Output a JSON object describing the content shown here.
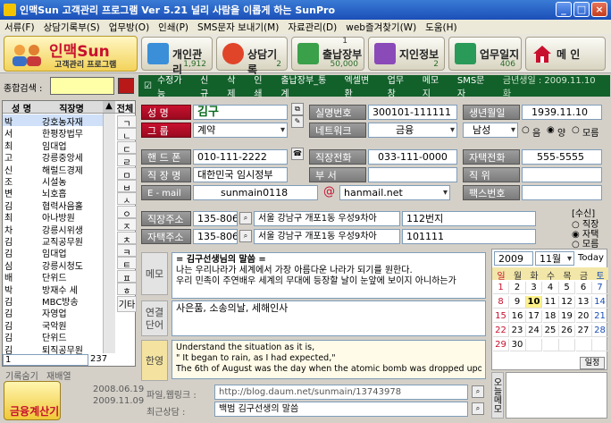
{
  "window": {
    "title": "인맥Sun 고객관리 프로그램 Ver 5.21 널리 사람을 이롭게 하는 SunPro",
    "min": "_",
    "max": "□",
    "close": "×"
  },
  "menu": [
    "서류(F)",
    "상담기록부(S)",
    "업무방(O)",
    "인쇄(P)",
    "SMS문자 보내기(M)",
    "자료관리(D)",
    "web즐겨찾기(W)",
    "도움(H)"
  ],
  "logo": {
    "title": "인맥Sun",
    "subtitle": "고객관리 프로그램"
  },
  "toolbar": [
    {
      "label": "개인관리",
      "count": "1,912",
      "top": ""
    },
    {
      "label": "상담기록",
      "count": "2",
      "top": ""
    },
    {
      "label": "출납장부",
      "count": "50,000",
      "top": "1"
    },
    {
      "label": "지인정보",
      "count": "2",
      "top": ""
    },
    {
      "label": "업무일지",
      "count": "406",
      "top": ""
    },
    {
      "label": "메 인",
      "count": "",
      "top": ""
    }
  ],
  "search": {
    "label": "종합검색 :",
    "value": ""
  },
  "greenbar": {
    "items": [
      "수정가능",
      "신규",
      "삭제",
      "인쇄",
      "출납장부_통계",
      "엑셀변환",
      "업무창",
      "메모지",
      "SMS문자"
    ],
    "date": "금년생일 : 2009.11.10 화"
  },
  "list": {
    "headers": [
      "성 명",
      "직장명",
      "전체"
    ],
    "rows": [
      {
        "name": "박",
        "job": "강호농자재"
      },
      {
        "name": "서",
        "job": "한평장법무"
      },
      {
        "name": "최",
        "job": "임대업"
      },
      {
        "name": "고",
        "job": "강릉중앙세"
      },
      {
        "name": "신",
        "job": "해럴드경제"
      },
      {
        "name": "조",
        "job": "시설농"
      },
      {
        "name": "변",
        "job": "뇌호흡"
      },
      {
        "name": "김",
        "job": "협력사음홀"
      },
      {
        "name": "최",
        "job": "아나방원"
      },
      {
        "name": "차",
        "job": "강릉시위생"
      },
      {
        "name": "김",
        "job": "교직공무원"
      },
      {
        "name": "김",
        "job": "임대업"
      },
      {
        "name": "심",
        "job": "강릉시청도"
      },
      {
        "name": "배",
        "job": "단위드"
      },
      {
        "name": "박",
        "job": "방재수 세"
      },
      {
        "name": "김",
        "job": "MBC방송"
      },
      {
        "name": "김",
        "job": "자영업"
      },
      {
        "name": "김",
        "job": "국악원"
      },
      {
        "name": "김",
        "job": "단위드"
      },
      {
        "name": "김",
        "job": "퇴직공무원"
      }
    ],
    "index": [
      "ㄱ",
      "ㄴ",
      "ㄷ",
      "ㄹ",
      "ㅁ",
      "ㅂ",
      "ㅅ",
      "ㅇ",
      "ㅈ",
      "ㅊ",
      "ㅋ",
      "ㅌ",
      "ㅍ",
      "ㅎ",
      "기타"
    ],
    "input_value": "1",
    "total": "237",
    "footer": [
      "기록숨기",
      "재배열"
    ],
    "dates": [
      "2008.06.19",
      "2009.11.09"
    ]
  },
  "form": {
    "name_label": "성 명",
    "name_value": "김구",
    "cat_label": "그 룹",
    "cat_value": "계약",
    "id_label": "실명번호",
    "id_value": "300101-111111",
    "birth_label": "생년월일",
    "birth_value": "1939.11.10",
    "net_label": "네트워크",
    "net_value": "금융",
    "gender_value": "남성",
    "radio": [
      "음",
      "양",
      "모름"
    ],
    "phone_label": "핸 드 폰",
    "phone_value": "010-111-2222",
    "work_label": "직 장 명",
    "work_value": "대한민국 임시정부",
    "email_label": "E - mail",
    "email_value": "sunmain0118",
    "email_domain": "hanmail.net",
    "wphone_label": "직장전화",
    "wphone_value": "033-111-0000",
    "dept_label": "부 서",
    "dept_value": "",
    "home_label": "자택전화",
    "home_value": "555-5555",
    "pos_label": "직 위",
    "pos_value": "",
    "fax_label": "팩스번호",
    "fax_value": "",
    "waddr_label": "직장주소",
    "waddr_zip": "135-806",
    "waddr1": "서울 강남구 개포1동 우성9차아",
    "waddr2": "112번지",
    "haddr_label": "자택주소",
    "haddr_zip": "135-806",
    "haddr1": "서울 강남구 개포1동 우성9차아",
    "haddr2": "101111",
    "recv_label": "[수신]",
    "recv_options": [
      "직장",
      "자택",
      "모름"
    ]
  },
  "memo": {
    "label": "메모",
    "lines": [
      "= 김구선생님의 말씀 =",
      "나는 우리나라가 세계에서 가장 아름다운 나라가 되기를 원한다.",
      "우리 민족이 주연배우 세계의 무대에 등장할 날이 눈앞에 보이지 아니하는가"
    ]
  },
  "link": {
    "label": "연결단어",
    "value": "사은품, 소송의날, 세해인사"
  },
  "english": {
    "label": "한영",
    "lines": [
      "Understand the situation as it is,",
      "\" It began to rain, as I had expected,\"",
      "The 6th of August was the day when the atomic bomb was dropped upon I"
    ]
  },
  "file": {
    "label": "파일,웹링크 :",
    "value": "http://blog.daum.net/sunmain/13743978"
  },
  "recent": {
    "label": "최근상담 :",
    "value": "백범 김구선생의 말씀"
  },
  "calendar": {
    "year": "2009",
    "month": "11월",
    "today": "Today",
    "days": [
      "일",
      "월",
      "화",
      "수",
      "목",
      "금",
      "토"
    ],
    "weeks": [
      [
        "1",
        "2",
        "3",
        "4",
        "5",
        "6",
        "7"
      ],
      [
        "8",
        "9",
        "10",
        "11",
        "12",
        "13",
        "14"
      ],
      [
        "15",
        "16",
        "17",
        "18",
        "19",
        "20",
        "21"
      ],
      [
        "22",
        "23",
        "24",
        "25",
        "26",
        "27",
        "28"
      ],
      [
        "29",
        "30",
        "",
        "",
        "",
        "",
        ""
      ]
    ],
    "schedule_btn": "일정",
    "side_label": "오늘메모"
  },
  "colors": {
    "green_bar": "#12602a",
    "label_red": "#c8102e"
  },
  "logo_bottom": "금융계산기"
}
